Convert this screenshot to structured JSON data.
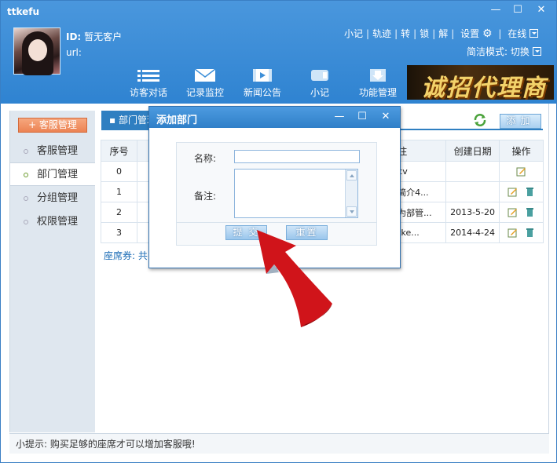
{
  "app": {
    "title": "ttkefu"
  },
  "profile": {
    "id_label": "ID:",
    "id_value": "暂无客户",
    "url_label": "url:",
    "url_value": ""
  },
  "top_links": {
    "note": "小记",
    "track": "轨迹",
    "transfer": "转",
    "lock": "锁",
    "solve": "解",
    "settings": "设置",
    "online": "在线",
    "simple_mode": "简洁模式: 切换"
  },
  "toolbar": [
    {
      "label": "访客对话",
      "icon": "list-icon"
    },
    {
      "label": "记录监控",
      "icon": "mail-icon"
    },
    {
      "label": "新闻公告",
      "icon": "video-icon"
    },
    {
      "label": "小记",
      "icon": "note-icon"
    },
    {
      "label": "功能管理",
      "icon": "download-icon"
    }
  ],
  "banner": {
    "text": "诚招代理商"
  },
  "sidebar": {
    "header_button": "+ 客服管理",
    "items": [
      {
        "label": "客服管理",
        "active": false
      },
      {
        "label": "部门管理",
        "active": true
      },
      {
        "label": "分组管理",
        "active": false
      },
      {
        "label": "权限管理",
        "active": false
      }
    ]
  },
  "main": {
    "tab_label": "部门管理",
    "add_button": "添加",
    "table": {
      "headers": [
        "序号",
        "",
        "",
        "",
        "注",
        "创建日期",
        "操作"
      ],
      "rows": [
        {
          "no": "0",
          "remark": "cv",
          "date": "",
          "actions": [
            "edit"
          ]
        },
        {
          "no": "1",
          "remark": "简介4...",
          "date": "",
          "actions": [
            "edit",
            "delete"
          ]
        },
        {
          "no": "2",
          "remark": "为部管...",
          "date": "2013-5-20",
          "actions": [
            "edit",
            "delete"
          ]
        },
        {
          "no": "3",
          "remark": "tke...",
          "date": "2014-4-24",
          "actions": [
            "edit",
            "delete"
          ]
        }
      ]
    },
    "seat_text": "座席券: 共"
  },
  "dialog": {
    "title": "添加部门",
    "name_label": "名称:",
    "name_value": "",
    "remark_label": "备注:",
    "remark_value": "",
    "submit": "提 交",
    "reset": "重置"
  },
  "footer": {
    "tip": "小提示: 购买足够的座席才可以增加客服哦!"
  },
  "colors": {
    "header": "#3d8fd8",
    "accent": "#2f7fc1",
    "sidebar_button": "#ec8353",
    "arrow": "#d0141a"
  }
}
